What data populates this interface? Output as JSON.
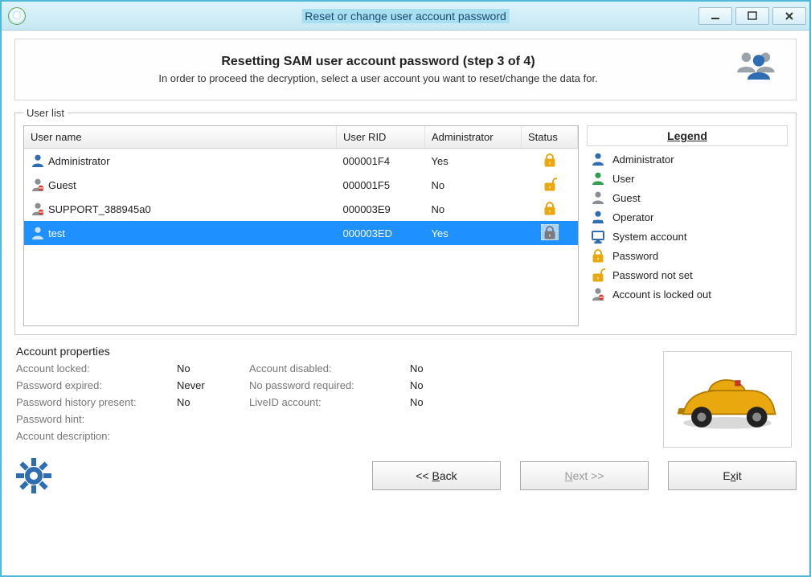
{
  "window": {
    "title": "Reset or change user account password"
  },
  "header": {
    "heading": "Resetting SAM user account password (step 3 of 4)",
    "subheading": "In order to proceed the decryption, select a user account you want to reset/change the data for."
  },
  "userlist": {
    "legend": "User list",
    "columns": {
      "name": "User name",
      "rid": "User RID",
      "admin": "Administrator",
      "status": "Status"
    },
    "rows": [
      {
        "name": "Administrator",
        "rid": "000001F4",
        "admin": "Yes",
        "status": "locked",
        "icon": "admin",
        "selected": false
      },
      {
        "name": "Guest",
        "rid": "000001F5",
        "admin": "No",
        "status": "nopass",
        "icon": "guest-locked",
        "selected": false
      },
      {
        "name": "SUPPORT_388945a0",
        "rid": "000003E9",
        "admin": "No",
        "status": "locked",
        "icon": "guest-locked",
        "selected": false
      },
      {
        "name": "test",
        "rid": "000003ED",
        "admin": "Yes",
        "status": "locked",
        "icon": "admin",
        "selected": true
      }
    ]
  },
  "legend": {
    "title": "Legend",
    "items": [
      {
        "icon": "admin",
        "label": "Administrator"
      },
      {
        "icon": "user",
        "label": "User"
      },
      {
        "icon": "guest",
        "label": "Guest"
      },
      {
        "icon": "operator",
        "label": "Operator"
      },
      {
        "icon": "system",
        "label": "System account"
      },
      {
        "icon": "locked",
        "label": "Password"
      },
      {
        "icon": "nopass",
        "label": "Password not set"
      },
      {
        "icon": "lockedout",
        "label": "Account is locked out"
      }
    ]
  },
  "account": {
    "title": "Account properties",
    "labels": {
      "locked": "Account locked:",
      "disabled": "Account disabled:",
      "expired": "Password expired:",
      "nopass": "No password required:",
      "history": "Password history present:",
      "liveid": "LiveID account:",
      "hint": "Password hint:",
      "desc": "Account description:"
    },
    "values": {
      "locked": "No",
      "disabled": "No",
      "expired": "Never",
      "nopass": "No",
      "history": "No",
      "liveid": "No",
      "hint": "",
      "desc": ""
    }
  },
  "buttons": {
    "back": "<< Back",
    "next": "Next >>",
    "exit": "Exit"
  }
}
